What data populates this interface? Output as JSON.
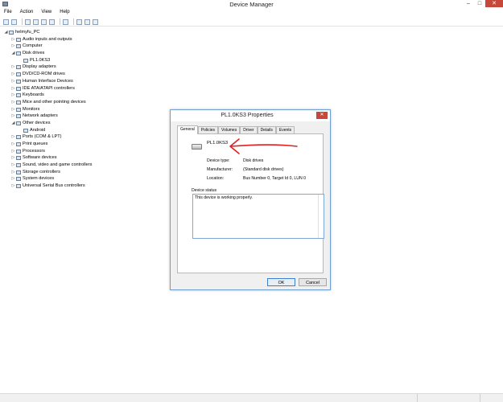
{
  "window": {
    "title": "Device Manager",
    "min": "–",
    "max": "□",
    "close": "✕"
  },
  "menu": [
    "File",
    "Action",
    "View",
    "Help"
  ],
  "tree": [
    {
      "label": "helmyfu_PC",
      "level": 0,
      "exp": "◢"
    },
    {
      "label": "Audio inputs and outputs",
      "level": 1,
      "exp": "▷"
    },
    {
      "label": "Computer",
      "level": 1,
      "exp": "▷"
    },
    {
      "label": "Disk drives",
      "level": 1,
      "exp": "◢"
    },
    {
      "label": "PL1.0KS3",
      "level": 2,
      "exp": ""
    },
    {
      "label": "Display adapters",
      "level": 1,
      "exp": "▷"
    },
    {
      "label": "DVD/CD-ROM drives",
      "level": 1,
      "exp": "▷"
    },
    {
      "label": "Human Interface Devices",
      "level": 1,
      "exp": "▷"
    },
    {
      "label": "IDE ATA/ATAPI controllers",
      "level": 1,
      "exp": "▷"
    },
    {
      "label": "Keyboards",
      "level": 1,
      "exp": "▷"
    },
    {
      "label": "Mice and other pointing devices",
      "level": 1,
      "exp": "▷"
    },
    {
      "label": "Monitors",
      "level": 1,
      "exp": "▷"
    },
    {
      "label": "Network adapters",
      "level": 1,
      "exp": "▷"
    },
    {
      "label": "Other devices",
      "level": 1,
      "exp": "◢"
    },
    {
      "label": "Android",
      "level": 2,
      "exp": ""
    },
    {
      "label": "Ports (COM & LPT)",
      "level": 1,
      "exp": "▷"
    },
    {
      "label": "Print queues",
      "level": 1,
      "exp": "▷"
    },
    {
      "label": "Processors",
      "level": 1,
      "exp": "▷"
    },
    {
      "label": "Software devices",
      "level": 1,
      "exp": "▷"
    },
    {
      "label": "Sound, video and game controllers",
      "level": 1,
      "exp": "▷"
    },
    {
      "label": "Storage controllers",
      "level": 1,
      "exp": "▷"
    },
    {
      "label": "System devices",
      "level": 1,
      "exp": "▷"
    },
    {
      "label": "Universal Serial Bus controllers",
      "level": 1,
      "exp": "▷"
    }
  ],
  "dialog": {
    "title": "PL1.0KS3 Properties",
    "close": "✕",
    "tabs": [
      "General",
      "Policies",
      "Volumes",
      "Driver",
      "Details",
      "Events"
    ],
    "device_name": "PL1.0KS3",
    "properties": [
      {
        "key": "Device type:",
        "value": "Disk drives"
      },
      {
        "key": "Manufacturer:",
        "value": "(Standard disk drives)"
      },
      {
        "key": "Location:",
        "value": "Bus Number 0, Target Id 0, LUN 0"
      }
    ],
    "status_label": "Device status",
    "status_text": "This device is working properly.",
    "ok": "OK",
    "cancel": "Cancel"
  },
  "colors": {
    "annotation_arrow": "#e02020",
    "close_button": "#c7473b",
    "focus_border": "#3c7fd1"
  }
}
